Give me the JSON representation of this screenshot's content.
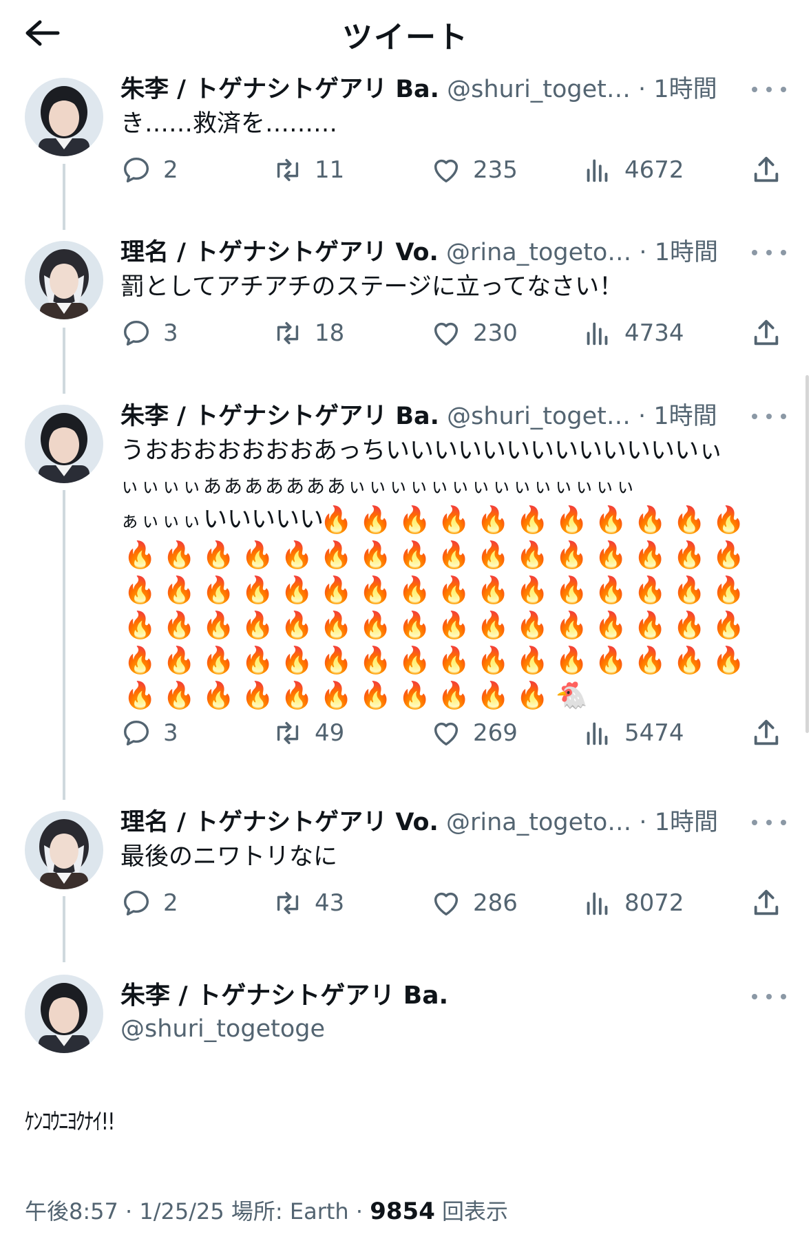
{
  "header": {
    "title": "ツイート",
    "back_icon": "arrow-left-icon"
  },
  "tweets": [
    {
      "name": "朱李 / トゲナシトゲアリ Ba.",
      "handle": "@shuri_toget…",
      "time": "1時間",
      "text": "き……救済を………",
      "replies": "2",
      "retweets": "11",
      "likes": "235",
      "views": "4672"
    },
    {
      "name": "理名 / トゲナシトゲアリ Vo.",
      "handle": "@rina_togeto…",
      "time": "1時間",
      "text": "罰としてアチアチのステージに立ってなさい！",
      "replies": "3",
      "retweets": "18",
      "likes": "230",
      "views": "4734"
    },
    {
      "name": "朱李 / トゲナシトゲアリ Ba.",
      "handle": "@shuri_toget…",
      "time": "1時間",
      "text_line1": "うおおおおおおおあっちいいいいいいいいいいいいいぃ",
      "text_line2": "ぃぃぃぃあああああああぃぃぃぃぃぃぃぃぃぃぃぃぃぃ",
      "text_line3a": "ぁぃぃぃ",
      "text_line3b": "いいいいい",
      "flame_emoji": "🔥",
      "flame_count": 86,
      "chicken_emoji": "🐔",
      "replies": "3",
      "retweets": "49",
      "likes": "269",
      "views": "5474"
    },
    {
      "name": "理名 / トゲナシトゲアリ Vo.",
      "handle": "@rina_togeto…",
      "time": "1時間",
      "text": "最後のニワトリなに",
      "replies": "2",
      "retweets": "43",
      "likes": "286",
      "views": "8072"
    }
  ],
  "focused": {
    "name": "朱李 / トゲナシトゲアリ Ba.",
    "handle": "@shuri_togetoge",
    "text": "ｹﾝｺｳﾆﾖｸﾅｲ!!",
    "time": "午後8:57",
    "date": "1/25/25",
    "location": "場所: Earth",
    "views": "9854",
    "views_label": "回表示"
  },
  "colors": {
    "text": "#0f1419",
    "muted": "#536471",
    "line": "#cfd9de"
  }
}
